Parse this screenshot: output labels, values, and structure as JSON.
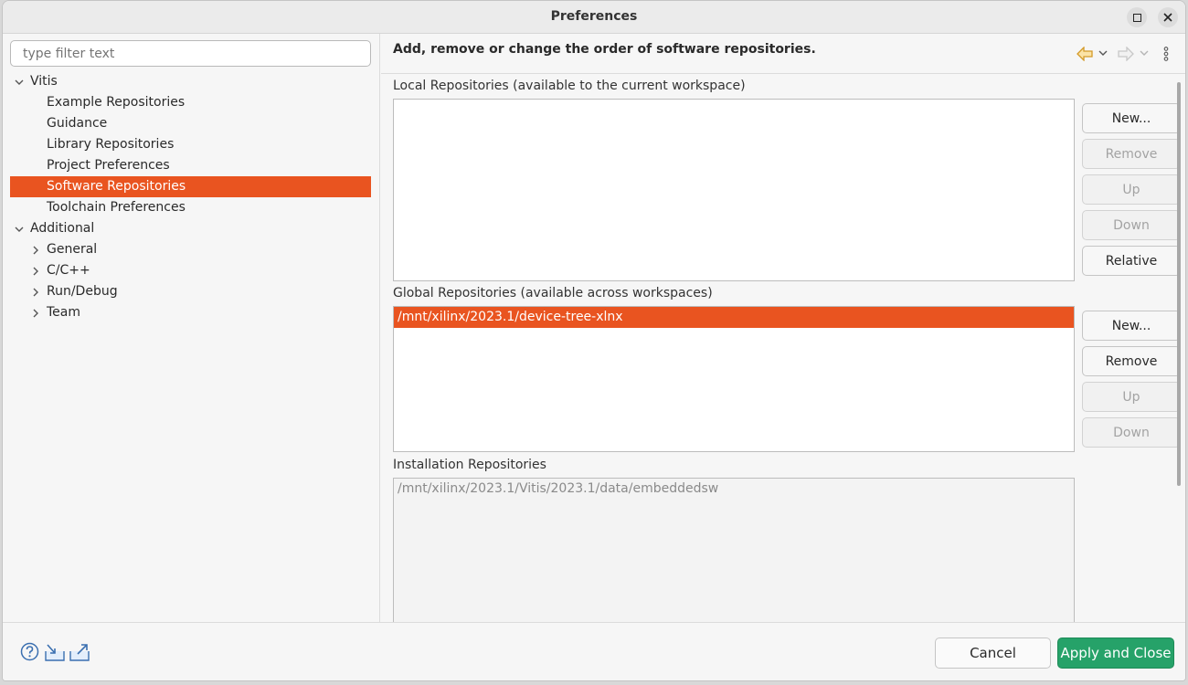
{
  "window": {
    "title": "Preferences"
  },
  "filter": {
    "placeholder": "type filter text"
  },
  "tree": [
    {
      "label": "Vitis",
      "level": 0,
      "expanded": true
    },
    {
      "label": "Example Repositories",
      "level": 1
    },
    {
      "label": "Guidance",
      "level": 1
    },
    {
      "label": "Library Repositories",
      "level": 1
    },
    {
      "label": "Project Preferences",
      "level": 1
    },
    {
      "label": "Software Repositories",
      "level": 1,
      "selected": true
    },
    {
      "label": "Toolchain Preferences",
      "level": 1
    },
    {
      "label": "Additional",
      "level": 0,
      "expanded": true
    },
    {
      "label": "General",
      "level": 1,
      "collapsed": true
    },
    {
      "label": "C/C++",
      "level": 1,
      "collapsed": true
    },
    {
      "label": "Run/Debug",
      "level": 1,
      "collapsed": true
    },
    {
      "label": "Team",
      "level": 1,
      "collapsed": true
    }
  ],
  "page": {
    "heading": "Add, remove or change the order of software repositories.",
    "local": {
      "label": "Local Repositories (available to the current workspace)",
      "items": [],
      "buttons": {
        "new": "New...",
        "remove": "Remove",
        "up": "Up",
        "down": "Down",
        "relative": "Relative"
      }
    },
    "global": {
      "label": "Global Repositories (available across workspaces)",
      "items": [
        "/mnt/xilinx/2023.1/device-tree-xlnx"
      ],
      "buttons": {
        "new": "New...",
        "remove": "Remove",
        "up": "Up",
        "down": "Down"
      }
    },
    "installation": {
      "label": "Installation Repositories",
      "items": [
        "/mnt/xilinx/2023.1/Vitis/2023.1/data/embeddedsw"
      ]
    }
  },
  "footer": {
    "cancel": "Cancel",
    "apply": "Apply and Close"
  },
  "colors": {
    "selection": "#e95420",
    "apply_button": "#26a269",
    "back_arrow": "#e0a030"
  },
  "icons": [
    "help-icon",
    "import-icon",
    "export-icon",
    "back-arrow-icon",
    "forward-arrow-icon",
    "view-menu-icon"
  ]
}
